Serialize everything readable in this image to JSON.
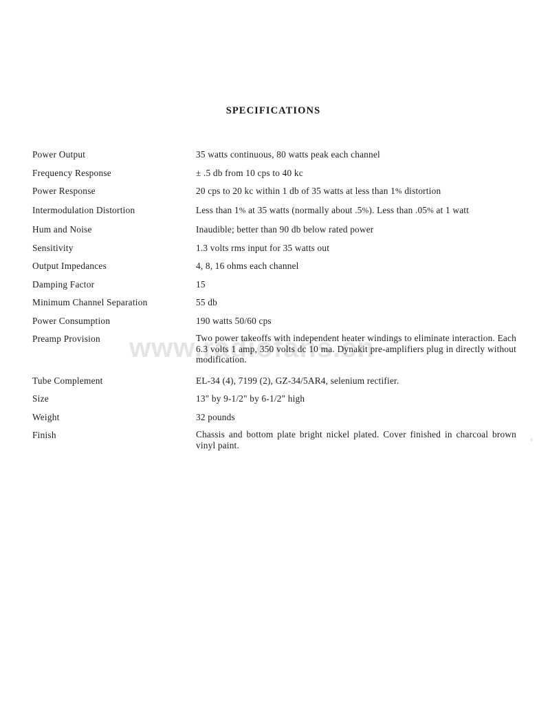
{
  "document": {
    "title": "SPECIFICATIONS",
    "watermark": "www.radiofans.cn"
  },
  "specs": [
    {
      "label": "Power Output",
      "value": "35 watts continuous, 80 watts peak each channel",
      "type": "single"
    },
    {
      "label": "Frequency Response",
      "value": "± .5 db from 10 cps to 40 kc",
      "type": "single"
    },
    {
      "label": "Power Response",
      "value": "20 cps to 20 kc within 1 db of 35 watts at less than 1% distortion",
      "type": "wide"
    },
    {
      "label": "Intermodulation Distortion",
      "value": "Less than 1% at 35 watts (normally about .5%).  Less than .05% at 1 watt",
      "type": "wide"
    },
    {
      "label": "Hum and Noise",
      "value": "Inaudible; better than 90 db below rated power",
      "type": "single"
    },
    {
      "label": "Sensitivity",
      "value": "1.3 volts rms input for 35 watts out",
      "type": "single"
    },
    {
      "label": "Output Impedances",
      "value": "4, 8, 16 ohms each channel",
      "type": "single"
    },
    {
      "label": "Damping Factor",
      "value": "15",
      "type": "single"
    },
    {
      "label": "Minimum Channel Separation",
      "value": "55 db",
      "type": "single"
    },
    {
      "label": "Power Consumption",
      "value": "190 watts 50/60 cps",
      "type": "single"
    },
    {
      "label": "Preamp Provision",
      "value": "Two power takeoffs with independent heater windings to eliminate interaction.  Each 6.3 volts 1 amp, 350 volts dc 10 ma.  Dynakit pre-amplifiers plug in directly without modification.",
      "type": "para"
    },
    {
      "label": "Tube Complement",
      "value": "EL-34 (4), 7199 (2), GZ-34/5AR4, selenium rectifier.",
      "type": "single"
    },
    {
      "label": "Size",
      "value": "13\" by 9-1/2\" by 6-1/2\" high",
      "type": "single"
    },
    {
      "label": "Weight",
      "value": "32 pounds",
      "type": "single"
    },
    {
      "label": "Finish",
      "value": "Chassis and bottom plate bright nickel plated.  Cover finished in charcoal brown vinyl paint.",
      "type": "para"
    }
  ]
}
